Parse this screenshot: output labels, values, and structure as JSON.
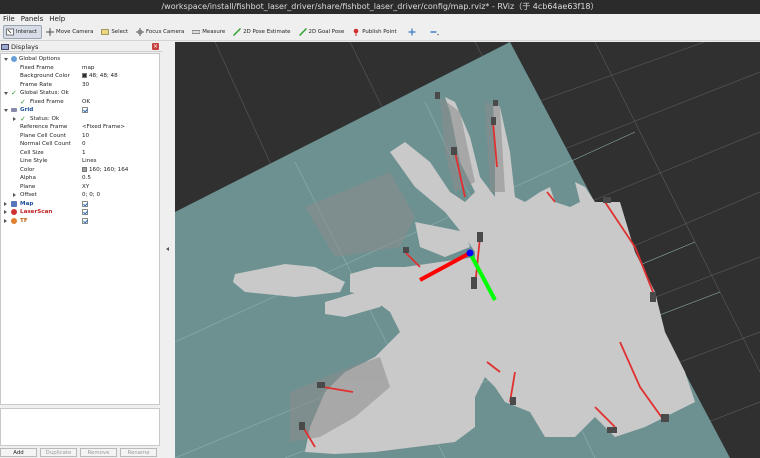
{
  "window": {
    "title": "/workspace/install/fishbot_laser_driver/share/fishbot_laser_driver/config/map.rviz* - RViz（于 4cb64ae63f18）"
  },
  "menu": [
    {
      "label": "File",
      "mnemonic": "F"
    },
    {
      "label": "Panels",
      "mnemonic": "P"
    },
    {
      "label": "Help",
      "mnemonic": "H"
    }
  ],
  "toolbar": {
    "interact": "Interact",
    "move_camera": "Move Camera",
    "select": "Select",
    "focus_camera": "Focus Camera",
    "measure": "Measure",
    "pose_estimate": "2D Pose Estimate",
    "goal_pose": "2D Goal Pose",
    "publish_point": "Publish Point"
  },
  "displays": {
    "title": "Displays",
    "rows": {
      "global_options": "Global Options",
      "fixed_frame_k": "Fixed Frame",
      "fixed_frame_v": "map",
      "background_k": "Background Color",
      "background_v": "48; 48; 48",
      "frame_rate_k": "Frame Rate",
      "frame_rate_v": "30",
      "global_status": "Global Status: Ok",
      "fixed_frame2_k": "Fixed Frame",
      "fixed_frame2_v": "OK",
      "grid": "Grid",
      "status_ok": "Status: Ok",
      "reference_frame_k": "Reference Frame",
      "reference_frame_v": "<Fixed Frame>",
      "plane_cell_count_k": "Plane Cell Count",
      "plane_cell_count_v": "10",
      "normal_cell_count_k": "Normal Cell Count",
      "normal_cell_count_v": "0",
      "cell_size_k": "Cell Size",
      "cell_size_v": "1",
      "line_style_k": "Line Style",
      "line_style_v": "Lines",
      "color_k": "Color",
      "color_v": "160; 160; 164",
      "alpha_k": "Alpha",
      "alpha_v": "0.5",
      "plane_k": "Plane",
      "plane_v": "XY",
      "offset_k": "Offset",
      "offset_v": "0; 0; 0",
      "map": "Map",
      "laserscan": "LaserScan",
      "tf": "TF"
    },
    "buttons": {
      "add": "Add",
      "duplicate": "Duplicate",
      "remove": "Remove",
      "rename": "Rename"
    }
  },
  "colors": {
    "background": "#303030",
    "grid_plane": "#6d9191",
    "free_space": "#c9c9c9",
    "laser": "#e03030",
    "axis_x": "#ff0000",
    "axis_y": "#00ff00",
    "axis_z": "#0000ff"
  }
}
